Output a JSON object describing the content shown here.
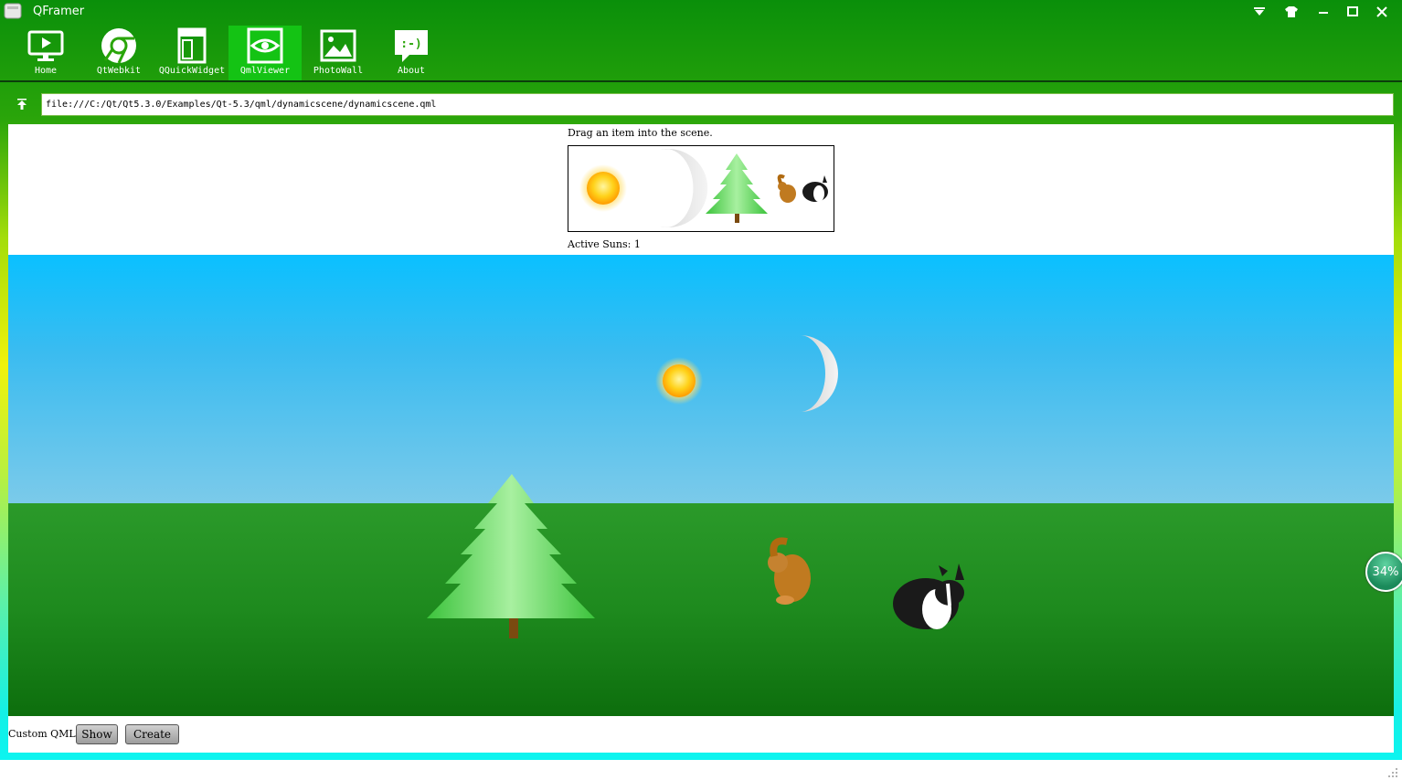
{
  "window": {
    "title": "QFramer",
    "controls": [
      "dropdown-icon",
      "skin-icon",
      "minimize-icon",
      "maximize-icon",
      "close-icon"
    ]
  },
  "toolbar": {
    "items": [
      {
        "label": "Home",
        "icon": "monitor-play-icon",
        "active": false
      },
      {
        "label": "QtWebkit",
        "icon": "chrome-icon",
        "active": false
      },
      {
        "label": "QQuickWidget",
        "icon": "layout-icon",
        "active": false
      },
      {
        "label": "QmlViewer",
        "icon": "eye-icon",
        "active": true
      },
      {
        "label": "PhotoWall",
        "icon": "picture-icon",
        "active": false
      },
      {
        "label": "About",
        "icon": "smiley-chat-icon",
        "active": false
      }
    ]
  },
  "address": {
    "url": "file:///C:/Qt/Qt5.3.0/Examples/Qt-5.3/qml/dynamicscene/dynamicscene.qml"
  },
  "scene": {
    "instruction": "Drag an item into the scene.",
    "palette_items": [
      "sun",
      "moon",
      "tree",
      "rabbit-brown",
      "rabbit-bw"
    ],
    "active_suns_label": "Active Suns: 1",
    "custom_qml_label": "Custom QML:",
    "show_button": "Show",
    "create_button": "Create"
  },
  "overlay": {
    "percent": "34%"
  },
  "colors": {
    "toolbar_active": "#14c314",
    "sky_top": "#0ac0ff",
    "ground": "#1e8a1e"
  }
}
